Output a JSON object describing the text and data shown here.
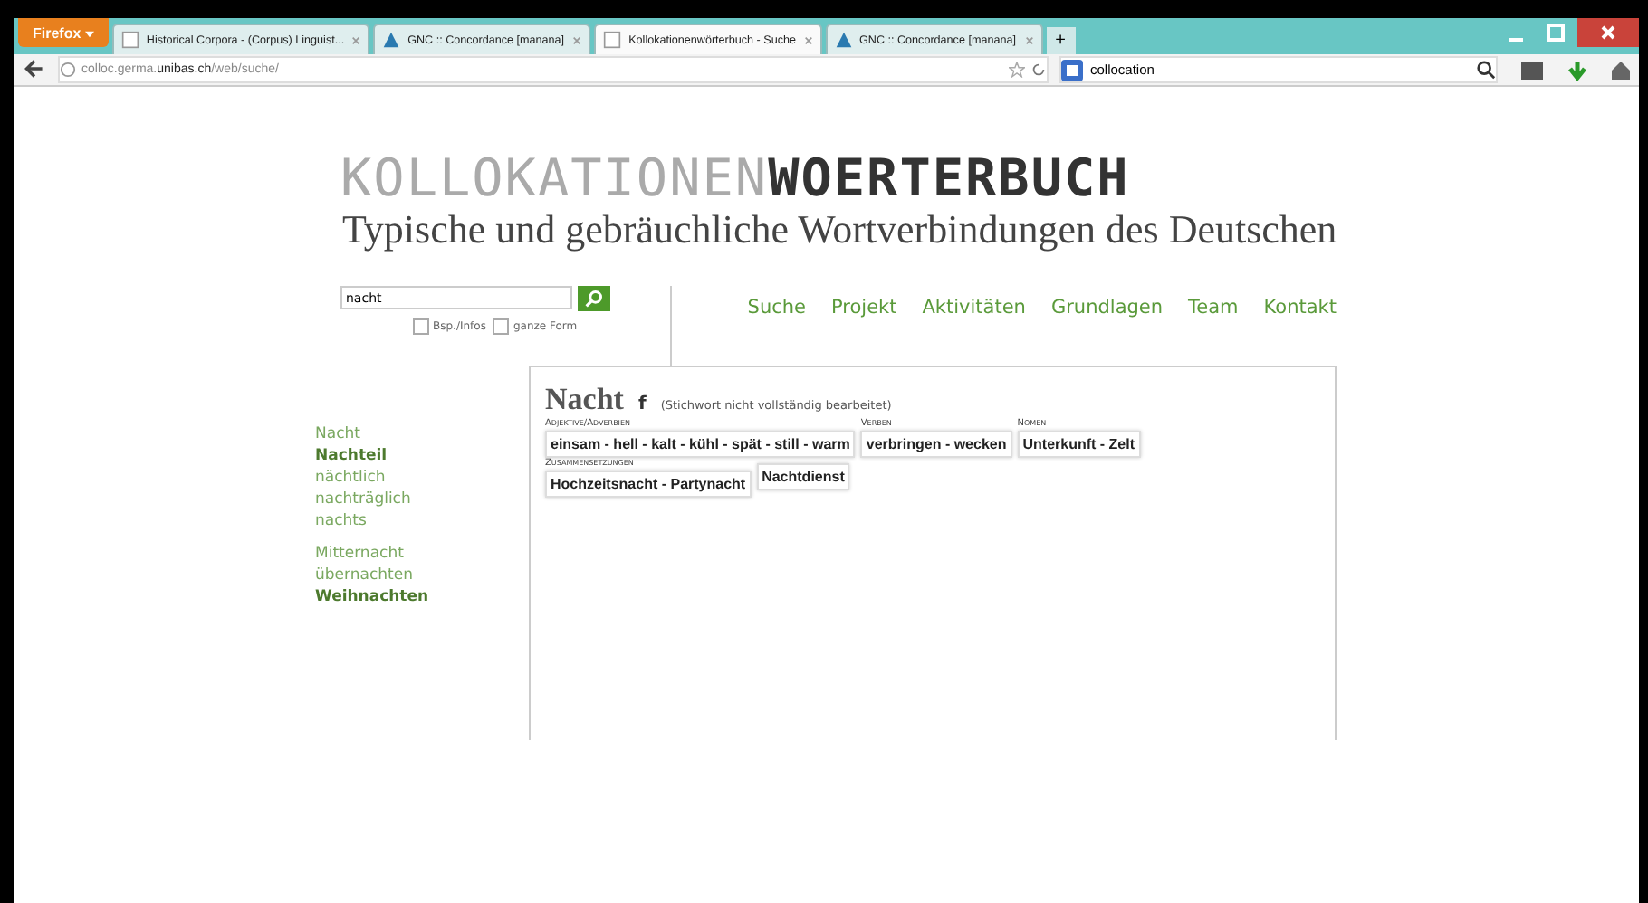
{
  "browser": {
    "menu_button": "Firefox",
    "tabs": [
      {
        "title": "Historical Corpora - (Corpus) Linguist...",
        "kind": "page",
        "selected": false
      },
      {
        "title": "GNC :: Concordance [manana]",
        "kind": "site",
        "selected": false
      },
      {
        "title": "Kollokationenwörterbuch - Suche",
        "kind": "page",
        "selected": true
      },
      {
        "title": "GNC :: Concordance [manana]",
        "kind": "site",
        "selected": false
      }
    ],
    "new_tab": "+",
    "url": "colloc.germa.**unibas.ch**/web/suche/",
    "search_value": "collocation"
  },
  "site": {
    "logo_light": "KOLLOKATIONEN",
    "logo_dark": "WOERTERBUCH",
    "tagline": "Typische und gebräuchliche Wortverbindungen des Deutschen"
  },
  "search": {
    "value": "nacht",
    "options": [
      {
        "label": "Bsp./Infos",
        "checked": false
      },
      {
        "label": "ganze Form",
        "checked": false
      }
    ]
  },
  "nav": [
    "Suche",
    "Projekt",
    "Aktivitäten",
    "Grundlagen",
    "Team",
    "Kontakt"
  ],
  "sidebar": {
    "groups": [
      [
        {
          "label": "Nacht",
          "highlighted": false
        },
        {
          "label": "Nachteil",
          "highlighted": true
        },
        {
          "label": "nächtlich",
          "highlighted": false
        },
        {
          "label": "nachträglich",
          "highlighted": false
        },
        {
          "label": "nachts",
          "highlighted": false
        }
      ],
      [
        {
          "label": "Mitternacht",
          "highlighted": false
        },
        {
          "label": "übernachten",
          "highlighted": false
        },
        {
          "label": "Weihnachten",
          "highlighted": true
        }
      ]
    ]
  },
  "entry": {
    "headword": "Nacht",
    "gender": "f",
    "note": "(Stichwort nicht vollständig bearbeitet)",
    "rows": [
      [
        {
          "category": "Adjektive/Adverbien",
          "boxes": [
            "einsam - hell - kalt - kühl - spät - still - warm"
          ]
        },
        {
          "category": "Verben",
          "boxes": [
            "verbringen - wecken"
          ]
        },
        {
          "category": "Nomen",
          "boxes": [
            "Unterkunft - Zelt"
          ]
        }
      ],
      [
        {
          "category": "Zusammensetzungen",
          "boxes": [
            "Hochzeitsnacht - Partynacht",
            "Nachtdienst"
          ]
        }
      ]
    ]
  }
}
